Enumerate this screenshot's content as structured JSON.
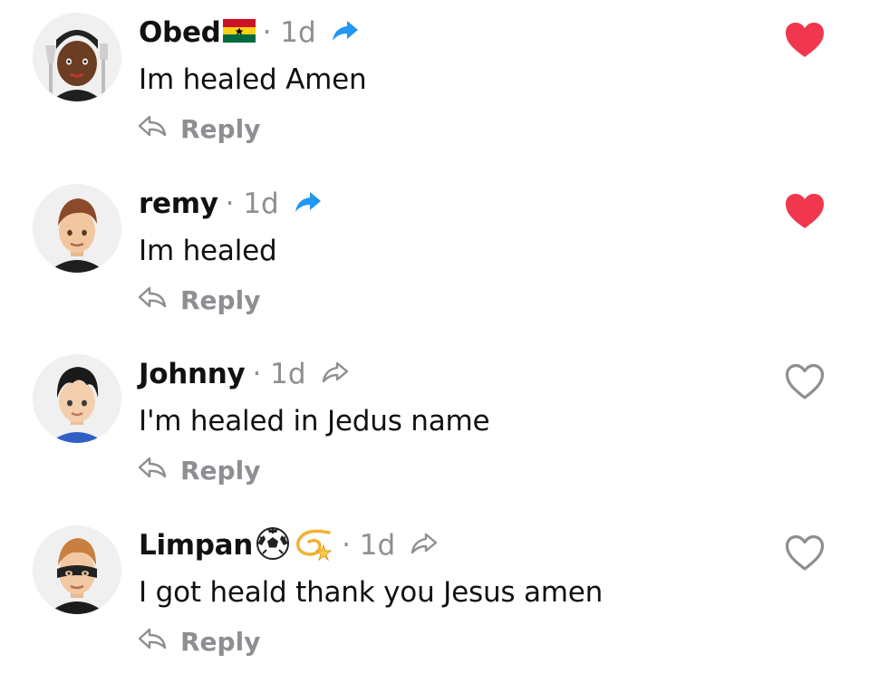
{
  "comments": [
    {
      "username": "Obed",
      "time": "· 1d",
      "text": "Im  healed Amen",
      "reply_label": "Reply",
      "liked": true,
      "shared": true,
      "emojis": [
        "ghana-flag"
      ],
      "avatar": {
        "skin": "#6b3d22",
        "hair": "#222222",
        "shirt": "#1f1f1f",
        "accessory": "fork-knife"
      }
    },
    {
      "username": "remy",
      "time": "· 1d",
      "text": "Im healed",
      "reply_label": "Reply",
      "liked": true,
      "shared": true,
      "emojis": [],
      "avatar": {
        "skin": "#f2c7a0",
        "hair": "#8b4a2b",
        "shirt": "#1e1e1e"
      }
    },
    {
      "username": "Johnny",
      "time": "· 1d",
      "text": "I'm healed in Jedus name",
      "reply_label": "Reply",
      "liked": false,
      "shared": false,
      "emojis": [],
      "avatar": {
        "skin": "#f4cfae",
        "hair": "#1a1a1a",
        "shirt": "#2f5fc4"
      }
    },
    {
      "username": "Limpan",
      "time": "· 1d",
      "text": "I got heald thank you Jesus amen",
      "reply_label": "Reply",
      "liked": false,
      "shared": false,
      "emojis": [
        "soccer-ball",
        "dizzy"
      ],
      "avatar": {
        "skin": "#f1c8a2",
        "hair": "#c9803e",
        "shirt": "#1c1c1c",
        "accessory": "eye-mask"
      }
    }
  ],
  "colors": {
    "heart_filled": "#f0374d",
    "heart_outline": "#8e8e93",
    "share_active": "#2196f3",
    "muted": "#8e8e93"
  },
  "icons": {
    "heart": "heart-icon",
    "share": "share-arrow-icon",
    "reply": "reply-arrow-icon"
  }
}
